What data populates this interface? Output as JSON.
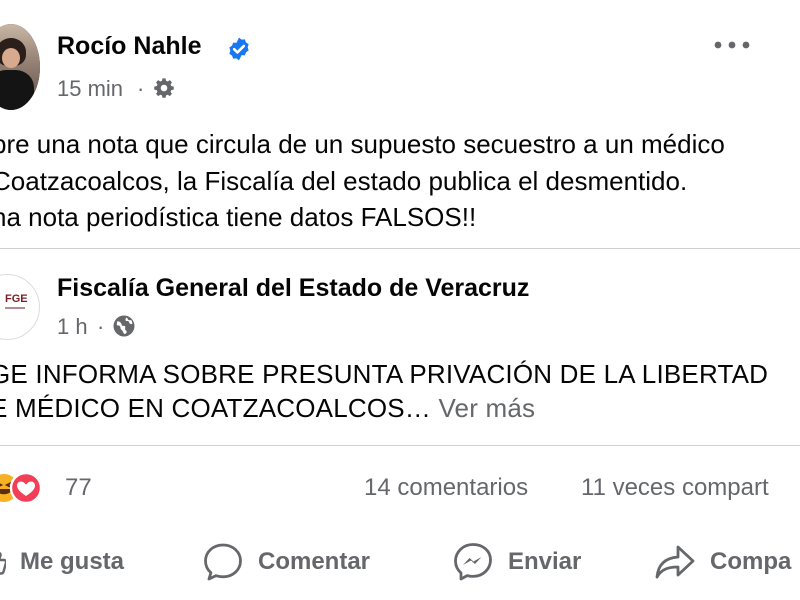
{
  "post": {
    "author_name": "Rocío Nahle",
    "time": "15 min",
    "separator": "·",
    "text_lines": [
      "bre una nota que circula de un supuesto secuestro a un médico",
      "Coatzacoalcos,  la Fiscalía del estado publica el desmentido.",
      "na nota periodística tiene datos FALSOS!!"
    ],
    "verified_icon": "verified-badge-icon",
    "audience_icon": "gear-icon",
    "menu_icon": "more-options-icon"
  },
  "shared": {
    "author_name": "Fiscalía General del Estado de Veracruz",
    "logo_text": "FGE",
    "time": "1 h",
    "separator": "·",
    "audience_icon": "globe-icon",
    "text_line1": "GE INFORMA SOBRE PRESUNTA PRIVACIÓN DE LA LIBERTAD",
    "text_line2": "E MÉDICO EN COATZACOALCOS…",
    "see_more": "Ver más"
  },
  "stats": {
    "reactions_count": "77",
    "reaction_icons": [
      "haha-reaction-icon",
      "love-reaction-icon"
    ],
    "comments": "14 comentarios",
    "shares": "11 veces compart"
  },
  "actions": {
    "like": "Me gusta",
    "comment": "Comentar",
    "send": "Enviar",
    "share": "Compa"
  },
  "colors": {
    "verified_blue": "#1877f2",
    "muted_text": "#65676b",
    "love_red": "#f33e58",
    "haha_yellow": "#f7b125",
    "divider": "#ced0d4"
  }
}
